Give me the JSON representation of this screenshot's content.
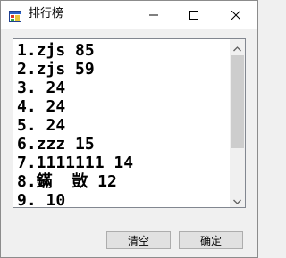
{
  "window": {
    "title": "排行榜"
  },
  "leaderboard": {
    "items": [
      "1.zjs 85",
      "2.zjs 59",
      "3. 24",
      "4. 24",
      "5. 24",
      "6.zzz 15",
      "7.1111111 14",
      "8.鏋  敳 12",
      "9. 10"
    ],
    "scroll_fraction_visible": 0.6,
    "scroll_position": 0
  },
  "buttons": {
    "clear_label": "清空",
    "ok_label": "确定"
  },
  "icons": {
    "app": "app-window-icon",
    "minimize": "minimize-icon",
    "maximize": "maximize-icon",
    "close": "close-icon",
    "scroll_up": "chevron-up-icon",
    "scroll_down": "chevron-down-icon"
  }
}
